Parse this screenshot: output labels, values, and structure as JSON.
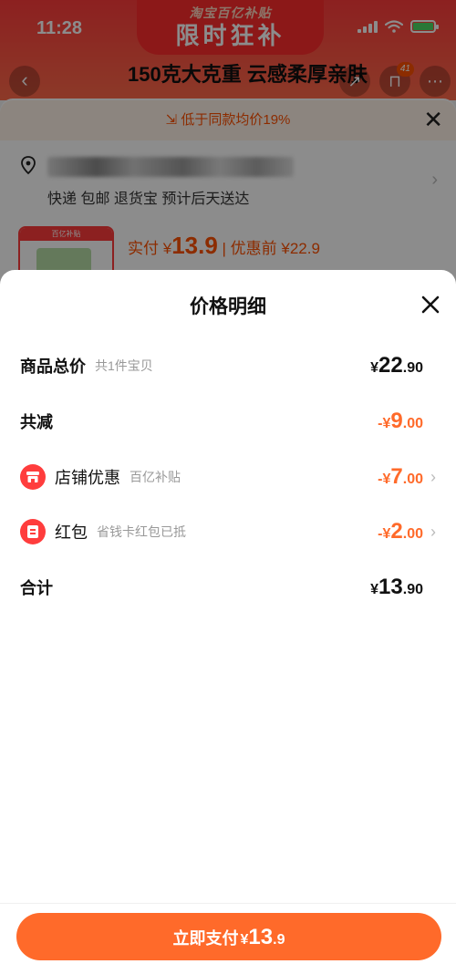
{
  "status_bar": {
    "time": "11:28"
  },
  "banner": {
    "line1": "淘宝百亿补贴",
    "line2": "限时狂补"
  },
  "nav": {
    "title": "150克大克重 云感柔厚亲肤",
    "cart_count": "41"
  },
  "background": {
    "promo_text": "低于同款均价19%",
    "shipping": "快递 包邮 退货宝 预计后天送达",
    "thumb_label": "百亿补贴",
    "paid_label": "实付 ¥",
    "paid_value": "13.9",
    "before_label": "| 优惠前 ¥22.9"
  },
  "modal": {
    "title": "价格明细",
    "rows": [
      {
        "label": "商品总价",
        "sub": "共1件宝贝",
        "currency": "¥",
        "int": "22",
        "dec": ".90"
      },
      {
        "label": "共减",
        "sub": "",
        "currency": "-¥",
        "int": "9",
        "dec": ".00"
      },
      {
        "label": "店铺优惠",
        "sub": "百亿补贴",
        "currency": "-¥",
        "int": "7",
        "dec": ".00"
      },
      {
        "label": "红包",
        "sub": "省钱卡红包已抵",
        "currency": "-¥",
        "int": "2",
        "dec": ".00"
      },
      {
        "label": "合计",
        "sub": "",
        "currency": "¥",
        "int": "13",
        "dec": ".90"
      }
    ]
  },
  "pay_button": {
    "label": "立即支付",
    "currency": "¥",
    "int": "13",
    "dec": ".9"
  },
  "colors": {
    "accent": "#ff6a2a",
    "red": "#ff3d3d",
    "promo_bg": "#fff2e8"
  }
}
